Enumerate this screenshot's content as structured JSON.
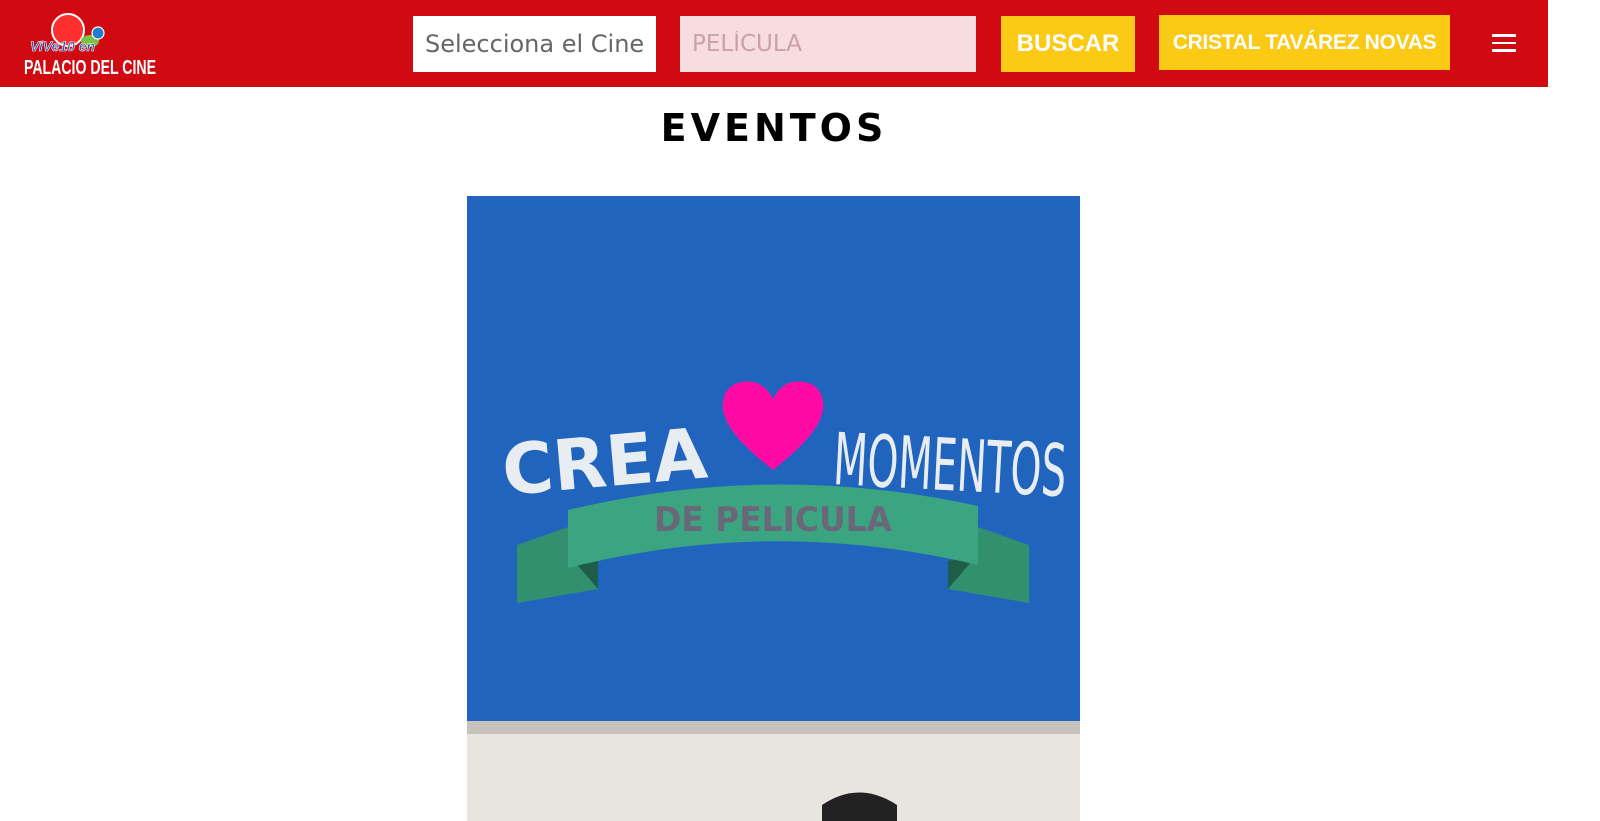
{
  "header": {
    "logo_line1": "ViVe10 en",
    "logo_line2": "PALACIO DEL CINE",
    "cinema_select_selected": "Selecciona el Cine",
    "movie_input_placeholder": "PELÍCULA",
    "movie_input_value": "",
    "search_button_label": "BUSCAR",
    "user_button_label": "CRISTAL TAVÁREZ NOVAS",
    "menu_icon": "hamburger-menu-icon"
  },
  "main": {
    "title": "EVENTOS",
    "event_banner": {
      "word1": "CREA",
      "word2": "MOMENTOS",
      "ribbon_text": "DE PELICULA",
      "icon": "heart-icon"
    }
  },
  "colors": {
    "header_bg": "#d10a11",
    "button_yellow": "#fbca15",
    "banner_blue": "#2064be",
    "heart_pink": "#ff0aa5",
    "ribbon_green": "#3ba582"
  }
}
